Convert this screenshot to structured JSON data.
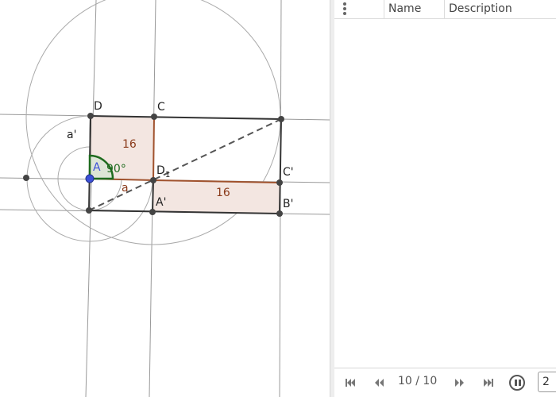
{
  "graphics": {
    "points": {
      "A": "A",
      "B": "",
      "C": "C",
      "D": "D",
      "A_prime": "A'",
      "B_prime": "B'",
      "C_prime": "C'",
      "D_prime": "D",
      "D_index": "1"
    },
    "segment_a": "a",
    "segment_a_prime": "a'",
    "area_square": "16",
    "area_rect": "16",
    "angle": "90°",
    "colors": {
      "polygon_fill": "#f3e6e1",
      "polygon_edge": "#a0522d",
      "angle_arc": "#1e6b1e",
      "point_A": "#3c50d8",
      "grid_lines": "#999999"
    }
  },
  "panel": {
    "columns": {
      "name": "Name",
      "description": "Description"
    },
    "navigation": {
      "step": "10 / 10",
      "speed": "2"
    }
  }
}
